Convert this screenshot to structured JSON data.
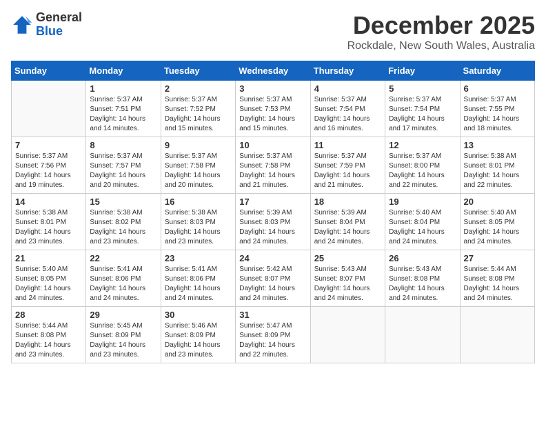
{
  "logo": {
    "general": "General",
    "blue": "Blue"
  },
  "title": "December 2025",
  "location": "Rockdale, New South Wales, Australia",
  "days_header": [
    "Sunday",
    "Monday",
    "Tuesday",
    "Wednesday",
    "Thursday",
    "Friday",
    "Saturday"
  ],
  "weeks": [
    [
      {
        "day": "",
        "empty": true
      },
      {
        "day": "1",
        "sunrise": "Sunrise: 5:37 AM",
        "sunset": "Sunset: 7:51 PM",
        "daylight": "Daylight: 14 hours and 14 minutes."
      },
      {
        "day": "2",
        "sunrise": "Sunrise: 5:37 AM",
        "sunset": "Sunset: 7:52 PM",
        "daylight": "Daylight: 14 hours and 15 minutes."
      },
      {
        "day": "3",
        "sunrise": "Sunrise: 5:37 AM",
        "sunset": "Sunset: 7:53 PM",
        "daylight": "Daylight: 14 hours and 15 minutes."
      },
      {
        "day": "4",
        "sunrise": "Sunrise: 5:37 AM",
        "sunset": "Sunset: 7:54 PM",
        "daylight": "Daylight: 14 hours and 16 minutes."
      },
      {
        "day": "5",
        "sunrise": "Sunrise: 5:37 AM",
        "sunset": "Sunset: 7:54 PM",
        "daylight": "Daylight: 14 hours and 17 minutes."
      },
      {
        "day": "6",
        "sunrise": "Sunrise: 5:37 AM",
        "sunset": "Sunset: 7:55 PM",
        "daylight": "Daylight: 14 hours and 18 minutes."
      }
    ],
    [
      {
        "day": "7",
        "sunrise": "Sunrise: 5:37 AM",
        "sunset": "Sunset: 7:56 PM",
        "daylight": "Daylight: 14 hours and 19 minutes."
      },
      {
        "day": "8",
        "sunrise": "Sunrise: 5:37 AM",
        "sunset": "Sunset: 7:57 PM",
        "daylight": "Daylight: 14 hours and 20 minutes."
      },
      {
        "day": "9",
        "sunrise": "Sunrise: 5:37 AM",
        "sunset": "Sunset: 7:58 PM",
        "daylight": "Daylight: 14 hours and 20 minutes."
      },
      {
        "day": "10",
        "sunrise": "Sunrise: 5:37 AM",
        "sunset": "Sunset: 7:58 PM",
        "daylight": "Daylight: 14 hours and 21 minutes."
      },
      {
        "day": "11",
        "sunrise": "Sunrise: 5:37 AM",
        "sunset": "Sunset: 7:59 PM",
        "daylight": "Daylight: 14 hours and 21 minutes."
      },
      {
        "day": "12",
        "sunrise": "Sunrise: 5:37 AM",
        "sunset": "Sunset: 8:00 PM",
        "daylight": "Daylight: 14 hours and 22 minutes."
      },
      {
        "day": "13",
        "sunrise": "Sunrise: 5:38 AM",
        "sunset": "Sunset: 8:01 PM",
        "daylight": "Daylight: 14 hours and 22 minutes."
      }
    ],
    [
      {
        "day": "14",
        "sunrise": "Sunrise: 5:38 AM",
        "sunset": "Sunset: 8:01 PM",
        "daylight": "Daylight: 14 hours and 23 minutes."
      },
      {
        "day": "15",
        "sunrise": "Sunrise: 5:38 AM",
        "sunset": "Sunset: 8:02 PM",
        "daylight": "Daylight: 14 hours and 23 minutes."
      },
      {
        "day": "16",
        "sunrise": "Sunrise: 5:38 AM",
        "sunset": "Sunset: 8:03 PM",
        "daylight": "Daylight: 14 hours and 23 minutes."
      },
      {
        "day": "17",
        "sunrise": "Sunrise: 5:39 AM",
        "sunset": "Sunset: 8:03 PM",
        "daylight": "Daylight: 14 hours and 24 minutes."
      },
      {
        "day": "18",
        "sunrise": "Sunrise: 5:39 AM",
        "sunset": "Sunset: 8:04 PM",
        "daylight": "Daylight: 14 hours and 24 minutes."
      },
      {
        "day": "19",
        "sunrise": "Sunrise: 5:40 AM",
        "sunset": "Sunset: 8:04 PM",
        "daylight": "Daylight: 14 hours and 24 minutes."
      },
      {
        "day": "20",
        "sunrise": "Sunrise: 5:40 AM",
        "sunset": "Sunset: 8:05 PM",
        "daylight": "Daylight: 14 hours and 24 minutes."
      }
    ],
    [
      {
        "day": "21",
        "sunrise": "Sunrise: 5:40 AM",
        "sunset": "Sunset: 8:05 PM",
        "daylight": "Daylight: 14 hours and 24 minutes."
      },
      {
        "day": "22",
        "sunrise": "Sunrise: 5:41 AM",
        "sunset": "Sunset: 8:06 PM",
        "daylight": "Daylight: 14 hours and 24 minutes."
      },
      {
        "day": "23",
        "sunrise": "Sunrise: 5:41 AM",
        "sunset": "Sunset: 8:06 PM",
        "daylight": "Daylight: 14 hours and 24 minutes."
      },
      {
        "day": "24",
        "sunrise": "Sunrise: 5:42 AM",
        "sunset": "Sunset: 8:07 PM",
        "daylight": "Daylight: 14 hours and 24 minutes."
      },
      {
        "day": "25",
        "sunrise": "Sunrise: 5:43 AM",
        "sunset": "Sunset: 8:07 PM",
        "daylight": "Daylight: 14 hours and 24 minutes."
      },
      {
        "day": "26",
        "sunrise": "Sunrise: 5:43 AM",
        "sunset": "Sunset: 8:08 PM",
        "daylight": "Daylight: 14 hours and 24 minutes."
      },
      {
        "day": "27",
        "sunrise": "Sunrise: 5:44 AM",
        "sunset": "Sunset: 8:08 PM",
        "daylight": "Daylight: 14 hours and 24 minutes."
      }
    ],
    [
      {
        "day": "28",
        "sunrise": "Sunrise: 5:44 AM",
        "sunset": "Sunset: 8:08 PM",
        "daylight": "Daylight: 14 hours and 23 minutes."
      },
      {
        "day": "29",
        "sunrise": "Sunrise: 5:45 AM",
        "sunset": "Sunset: 8:09 PM",
        "daylight": "Daylight: 14 hours and 23 minutes."
      },
      {
        "day": "30",
        "sunrise": "Sunrise: 5:46 AM",
        "sunset": "Sunset: 8:09 PM",
        "daylight": "Daylight: 14 hours and 23 minutes."
      },
      {
        "day": "31",
        "sunrise": "Sunrise: 5:47 AM",
        "sunset": "Sunset: 8:09 PM",
        "daylight": "Daylight: 14 hours and 22 minutes."
      },
      {
        "day": "",
        "empty": true
      },
      {
        "day": "",
        "empty": true
      },
      {
        "day": "",
        "empty": true
      }
    ]
  ]
}
